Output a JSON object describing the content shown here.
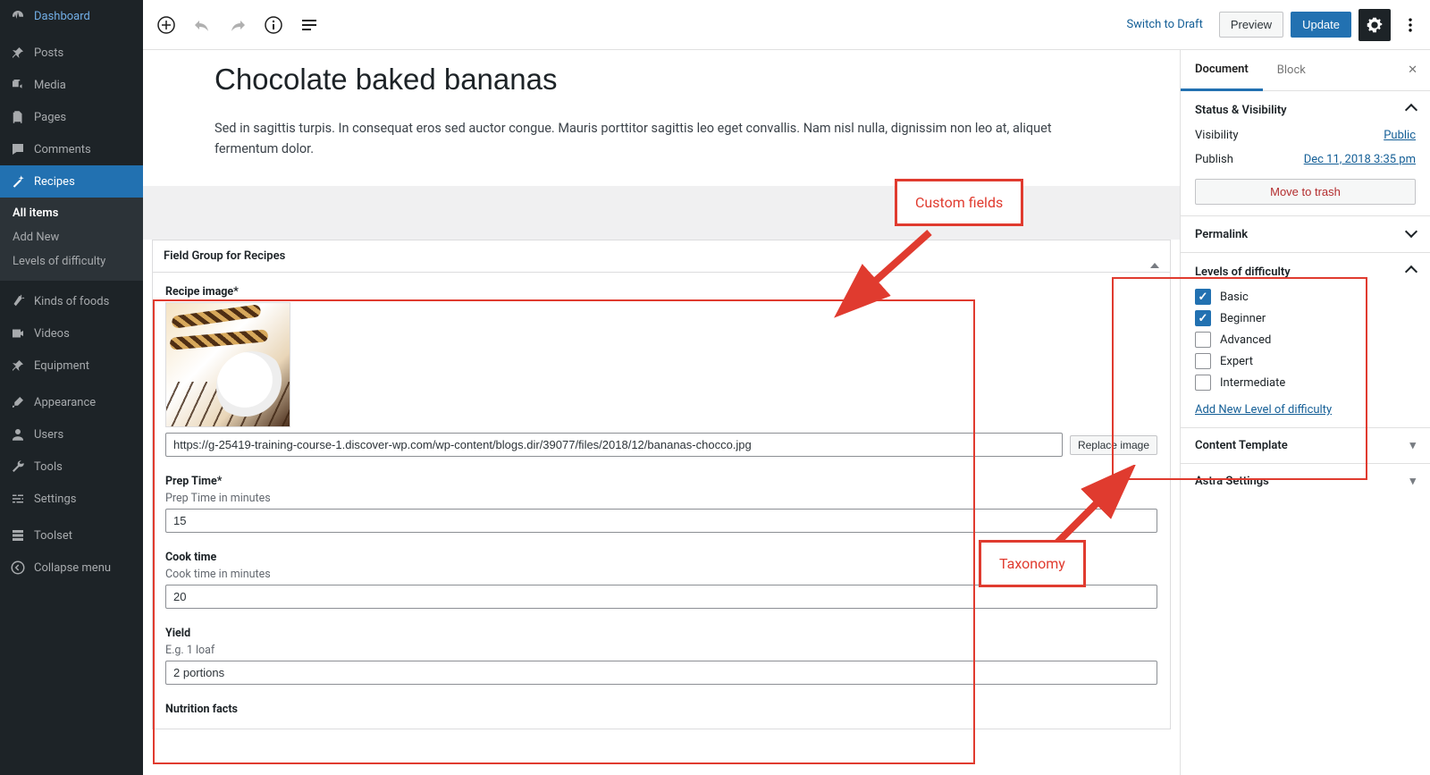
{
  "sidebar": {
    "items": [
      {
        "label": "Dashboard",
        "icon": "dashboard"
      },
      {
        "label": "Posts",
        "icon": "pin"
      },
      {
        "label": "Media",
        "icon": "media"
      },
      {
        "label": "Pages",
        "icon": "pages"
      },
      {
        "label": "Comments",
        "icon": "comments"
      },
      {
        "label": "Recipes",
        "icon": "wand",
        "active": true
      },
      {
        "label": "Kinds of foods",
        "icon": "carrot"
      },
      {
        "label": "Videos",
        "icon": "video"
      },
      {
        "label": "Equipment",
        "icon": "pin"
      },
      {
        "label": "Appearance",
        "icon": "brush"
      },
      {
        "label": "Users",
        "icon": "users"
      },
      {
        "label": "Tools",
        "icon": "wrench"
      },
      {
        "label": "Settings",
        "icon": "sliders"
      },
      {
        "label": "Toolset",
        "icon": "toolset"
      },
      {
        "label": "Collapse menu",
        "icon": "collapse"
      }
    ],
    "sub": {
      "items": [
        "All items",
        "Add New",
        "Levels of difficulty"
      ],
      "current": "All items"
    }
  },
  "toolbar": {
    "switch_to_draft": "Switch to Draft",
    "preview": "Preview",
    "update": "Update"
  },
  "post": {
    "title": "Chocolate baked bananas",
    "paragraph": "Sed in sagittis turpis. In consequat eros sed auctor congue. Mauris porttitor sagittis leo eget convallis. Nam nisl nulla, dignissim non leo at, aliquet fermentum dolor."
  },
  "metabox": {
    "title": "Field Group for Recipes",
    "fields": {
      "recipe_image_label": "Recipe image*",
      "image_url": "https://g-25419-training-course-1.discover-wp.com/wp-content/blogs.dir/39077/files/2018/12/bananas-chocco.jpg",
      "replace_image_btn": "Replace image",
      "prep_label": "Prep Time*",
      "prep_hint": "Prep Time in minutes",
      "prep_value": "15",
      "cook_label": "Cook time",
      "cook_hint": "Cook time in minutes",
      "cook_value": "20",
      "yield_label": "Yield",
      "yield_hint": "E.g. 1 loaf",
      "yield_value": "2 portions",
      "nutrition_label": "Nutrition facts"
    }
  },
  "settings": {
    "tabs": {
      "document": "Document",
      "block": "Block"
    },
    "status": {
      "title": "Status & Visibility",
      "visibility_label": "Visibility",
      "visibility_value": "Public",
      "publish_label": "Publish",
      "publish_value": "Dec 11, 2018 3:35 pm",
      "move_to_trash": "Move to trash"
    },
    "permalink_title": "Permalink",
    "levels": {
      "title": "Levels of difficulty",
      "options": [
        {
          "label": "Basic",
          "checked": true
        },
        {
          "label": "Beginner",
          "checked": true
        },
        {
          "label": "Advanced",
          "checked": false
        },
        {
          "label": "Expert",
          "checked": false
        },
        {
          "label": "Intermediate",
          "checked": false
        }
      ],
      "add_new": "Add New Level of difficulty"
    },
    "content_template_title": "Content Template",
    "astra_title": "Astra Settings"
  },
  "callouts": {
    "custom_fields": "Custom fields",
    "taxonomy": "Taxonomy"
  }
}
